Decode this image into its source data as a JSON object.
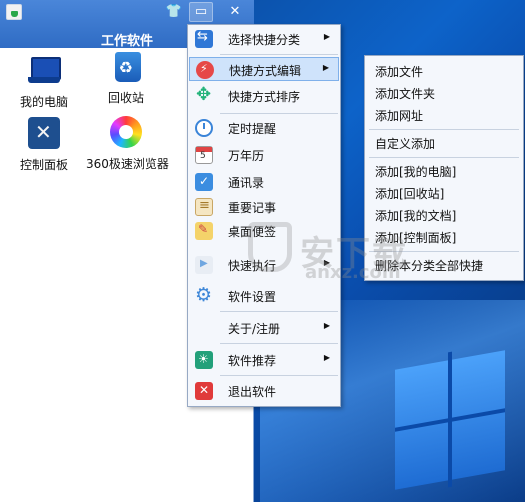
{
  "panel": {
    "title": "工作软件",
    "titlebar_buttons": [
      "shirt-icon",
      "restore-icon",
      "close-icon"
    ],
    "desktop_items": [
      {
        "label": "我的电脑",
        "icon": "laptop-icon"
      },
      {
        "label": "回收站",
        "icon": "recycle-bin-icon"
      },
      {
        "label": "控制面板",
        "icon": "control-panel-icon"
      },
      {
        "label": "360极速浏览器",
        "icon": "browser-icon"
      }
    ]
  },
  "menu": {
    "items": [
      {
        "label": "选择快捷分类",
        "has_submenu": true
      },
      {
        "label": "快捷方式编辑",
        "has_submenu": true,
        "active": true
      },
      {
        "label": "快捷方式排序",
        "has_submenu": false
      },
      {
        "label": "定时提醒",
        "has_submenu": false
      },
      {
        "label": "万年历",
        "has_submenu": false
      },
      {
        "label": "通讯录",
        "has_submenu": false
      },
      {
        "label": "重要记事",
        "has_submenu": false
      },
      {
        "label": "桌面便签",
        "has_submenu": false
      },
      {
        "label": "快速执行",
        "has_submenu": true
      },
      {
        "label": "软件设置",
        "has_submenu": false
      },
      {
        "label": "关于/注册",
        "has_submenu": true
      },
      {
        "label": "软件推荐",
        "has_submenu": true
      },
      {
        "label": "退出软件",
        "has_submenu": false
      }
    ]
  },
  "submenu": {
    "items": [
      "添加文件",
      "添加文件夹",
      "添加网址",
      "自定义添加",
      "添加[我的电脑]",
      "添加[回收站]",
      "添加[我的文档]",
      "添加[控制面板]",
      "删除本分类全部快捷"
    ]
  },
  "watermark": {
    "text": "安下载",
    "sub": "anxz.com"
  },
  "colors": {
    "titlebar": "#2f6cc4",
    "menu_bg": "#f4f7fc",
    "menu_active": "#cfe3fb",
    "desktop": "#0d63c9"
  }
}
